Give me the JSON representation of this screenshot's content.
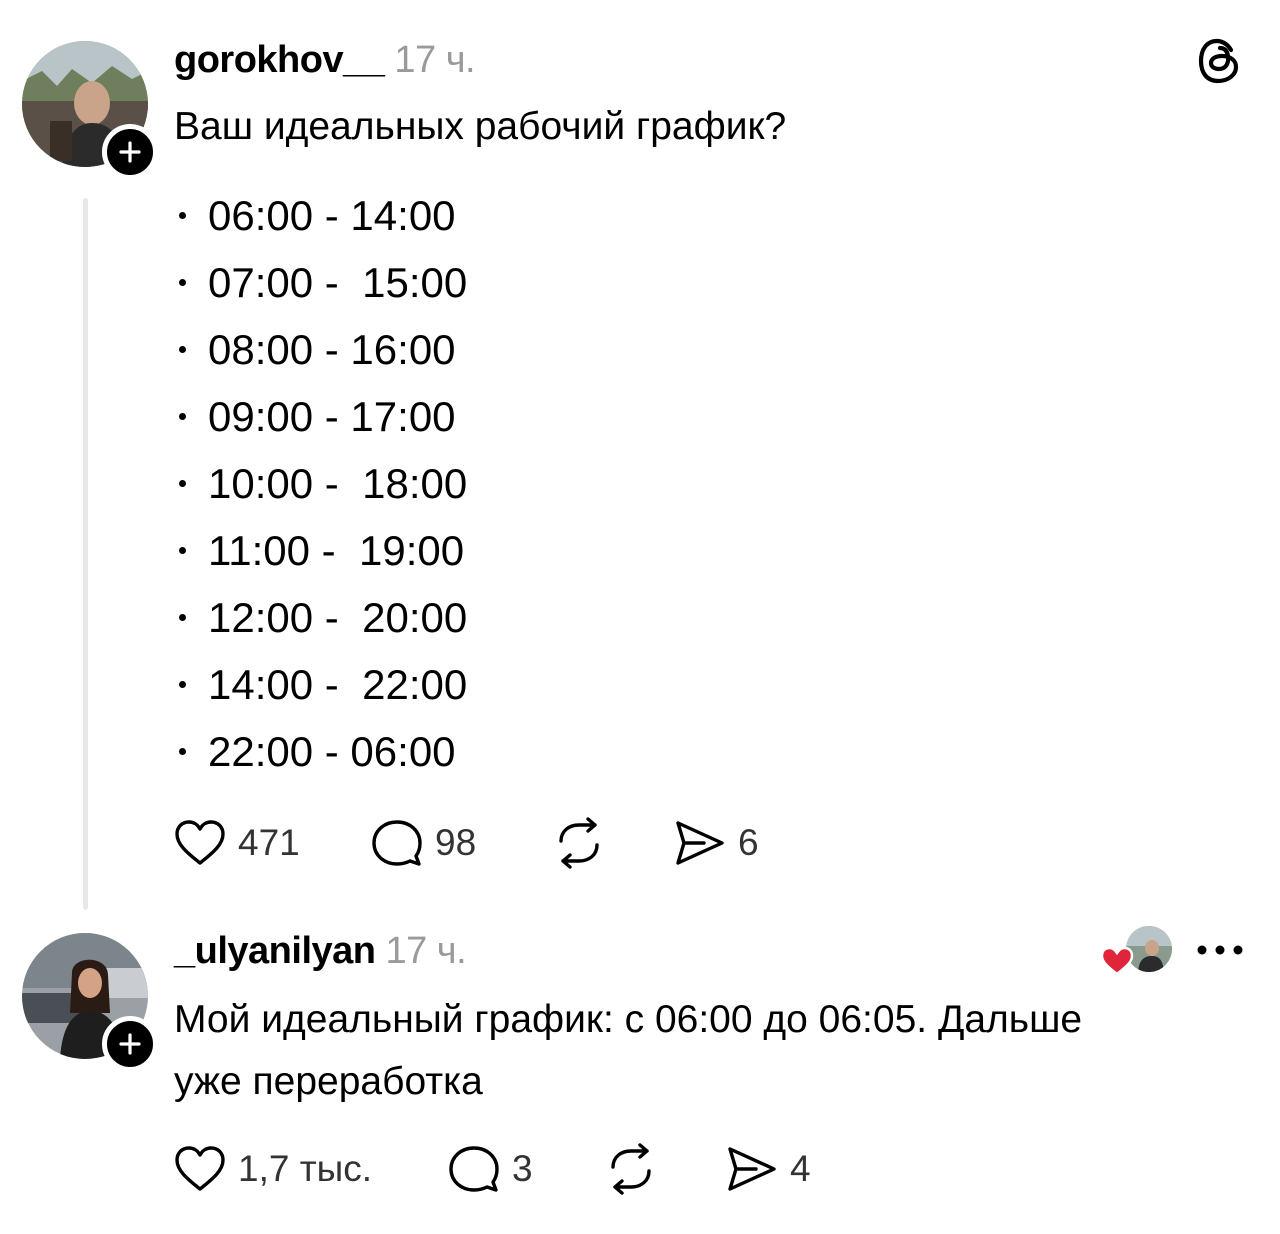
{
  "post": {
    "username": "gorokhov__",
    "time": "17 ч.",
    "text": "Ваш идеальных рабочий график?",
    "options": [
      "06:00 - 14:00",
      "07:00 -  15:00",
      "08:00 - 16:00",
      "09:00 - 17:00",
      "10:00 -  18:00",
      "11:00 -  19:00",
      "12:00 -  20:00",
      "14:00 -  22:00",
      "22:00 - 06:00"
    ],
    "stats": {
      "likes": "471",
      "replies": "98",
      "reposts": "",
      "shares": "6"
    }
  },
  "reply": {
    "username": "_ulyanilyan",
    "time": "17 ч.",
    "text": "Мой идеальный график: с 06:00 до 06:05. Дальше\nуже переработка",
    "stats": {
      "likes": "1,7 тыс.",
      "replies": "3",
      "reposts": "",
      "shares": "4"
    }
  },
  "icons": {
    "app_logo": "threads-logo-icon",
    "like": "heart-icon",
    "reply": "comment-bubble-icon",
    "repost": "repost-icon",
    "share": "send-icon",
    "more": "more-dots-icon",
    "follow": "plus-icon",
    "liked_by_author": "red-heart-icon"
  },
  "colors": {
    "text": "#000000",
    "muted": "#9a9a9a",
    "thread_line": "#e8e8e8",
    "liked_heart": "#e0243a"
  }
}
